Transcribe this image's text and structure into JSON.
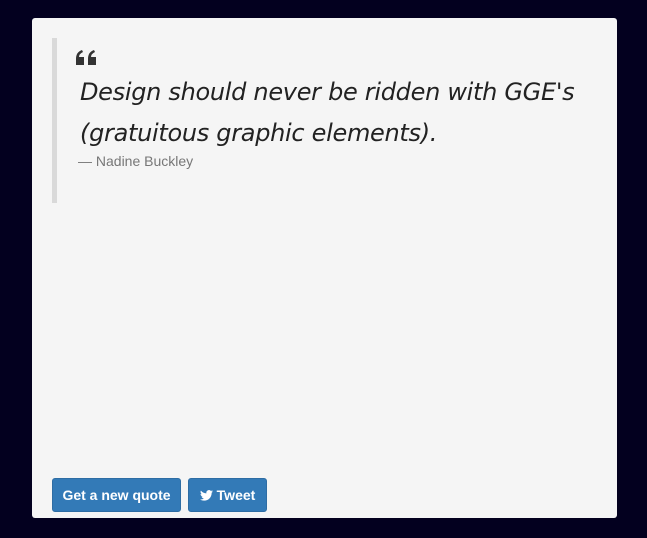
{
  "quote": {
    "text": "Design should never be ridden with GGE's (gratuitous graphic elements).",
    "author": "— Nadine Buckley"
  },
  "buttons": {
    "new_quote_label": "Get a new quote",
    "tweet_label": "Tweet"
  },
  "colors": {
    "page_background": "#03001f",
    "card_background": "#f5f5f5",
    "button_blue": "#337ab7",
    "quote_border": "#d9d9d9"
  },
  "icons": {
    "quote": "quote-left-icon",
    "tweet": "twitter-icon"
  }
}
